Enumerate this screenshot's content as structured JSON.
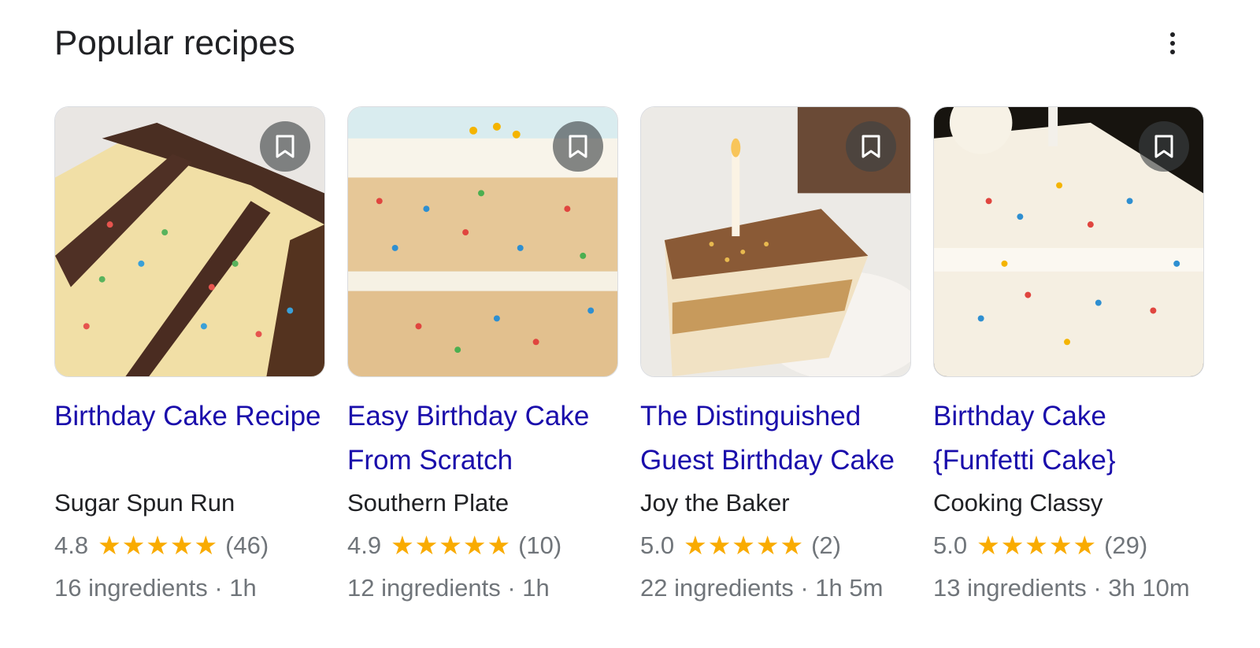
{
  "header": {
    "title": "Popular recipes",
    "more_icon": "more-vert-icon"
  },
  "save_icon": "bookmark-icon",
  "star_icon": "star-icon",
  "colors": {
    "link": "#1a0dab",
    "star": "#f9ab00",
    "muted": "#70757a",
    "text": "#202124"
  },
  "recipes": [
    {
      "title": "Birthday Cake Recipe",
      "source": "Sugar Spun Run",
      "rating": "4.8",
      "stars": 5,
      "reviews": "(46)",
      "meta": "16 ingredients · 1h"
    },
    {
      "title": "Easy Birthday Cake From Scratch",
      "source": "Southern Plate",
      "rating": "4.9",
      "stars": 5,
      "reviews": "(10)",
      "meta": "12 ingredients · 1h"
    },
    {
      "title": "The Distinguished Guest Birthday Cake",
      "source": "Joy the Baker",
      "rating": "5.0",
      "stars": 5,
      "reviews": "(2)",
      "meta": "22 ingredients · 1h 5m"
    },
    {
      "title": "Birthday Cake {Funfetti Cake}",
      "source": "Cooking Classy",
      "rating": "5.0",
      "stars": 5,
      "reviews": "(29)",
      "meta": "13 ingredients · 3h 10m"
    }
  ]
}
